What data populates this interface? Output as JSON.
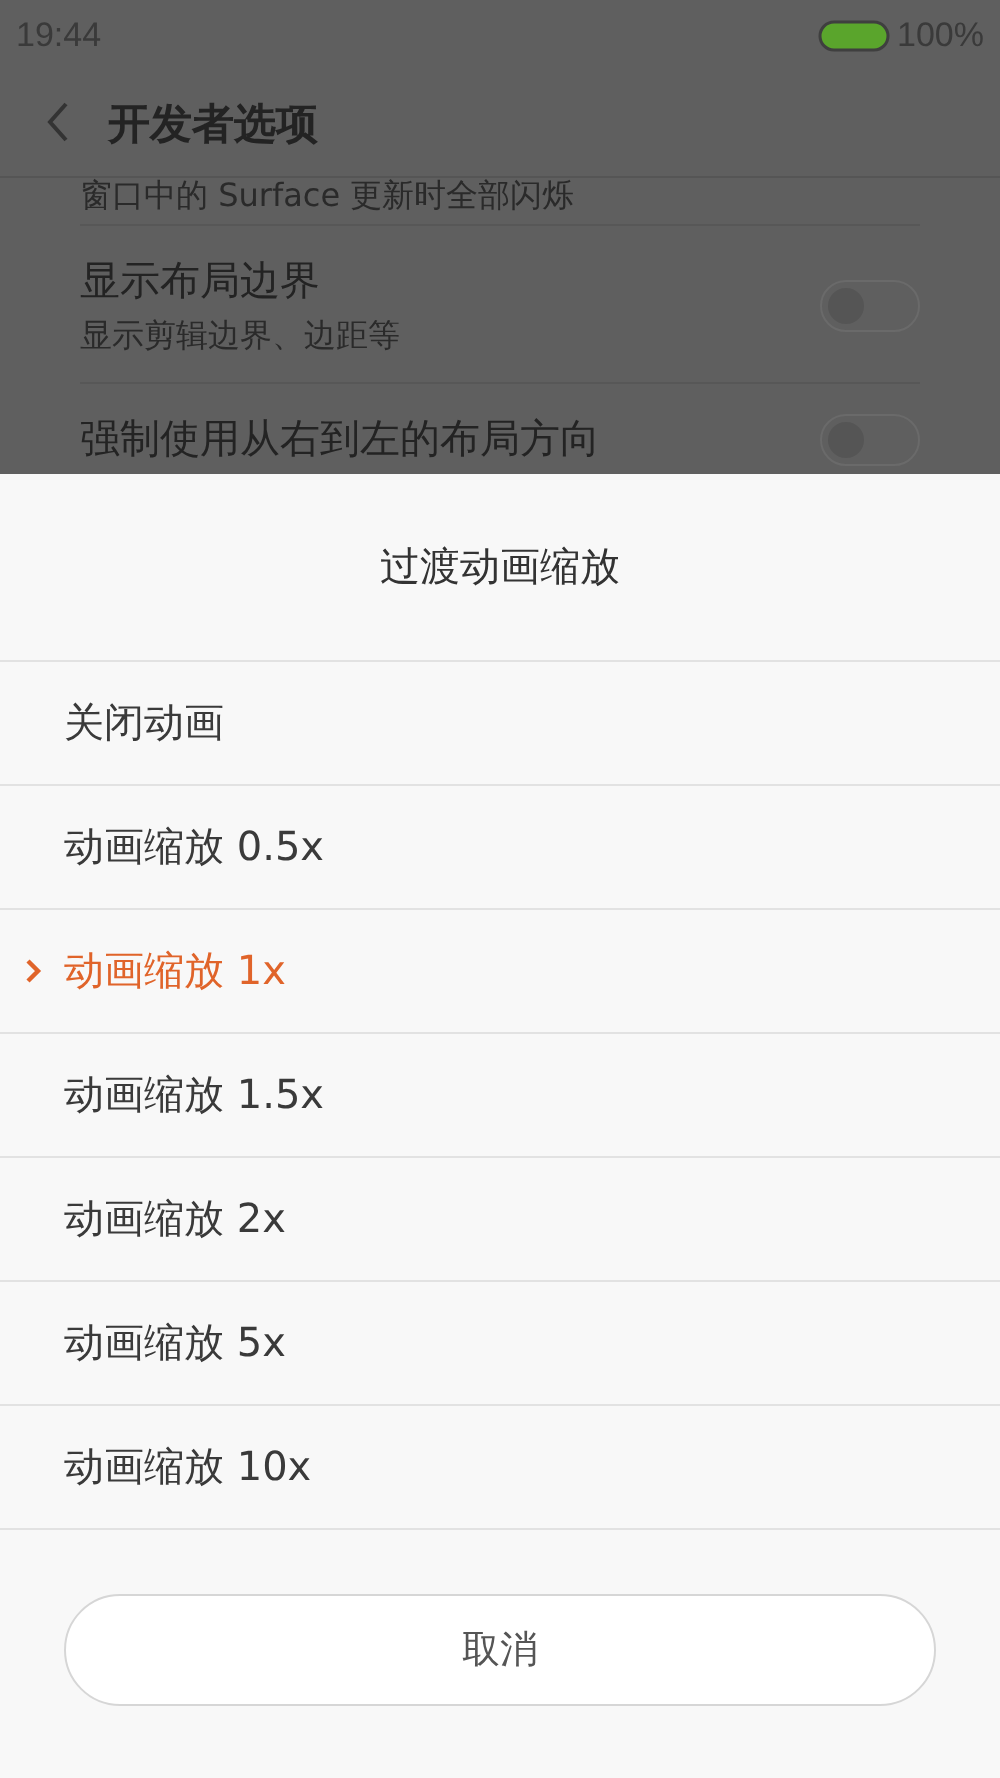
{
  "status_bar": {
    "time": "19:44",
    "battery": "100%"
  },
  "header": {
    "title": "开发者选项"
  },
  "partial_text": "窗口中的 Surface 更新时全部闪烁",
  "settings": [
    {
      "title": "显示布局边界",
      "subtitle": "显示剪辑边界、边距等",
      "on": false
    },
    {
      "title": "强制使用从右到左的布局方向",
      "on": false
    }
  ],
  "dialog": {
    "title": "过渡动画缩放",
    "options": [
      {
        "label": "关闭动画",
        "selected": false
      },
      {
        "label": "动画缩放 0.5x",
        "selected": false
      },
      {
        "label": "动画缩放 1x",
        "selected": true
      },
      {
        "label": "动画缩放 1.5x",
        "selected": false
      },
      {
        "label": "动画缩放 2x",
        "selected": false
      },
      {
        "label": "动画缩放 5x",
        "selected": false
      },
      {
        "label": "动画缩放 10x",
        "selected": false
      }
    ],
    "cancel": "取消"
  }
}
